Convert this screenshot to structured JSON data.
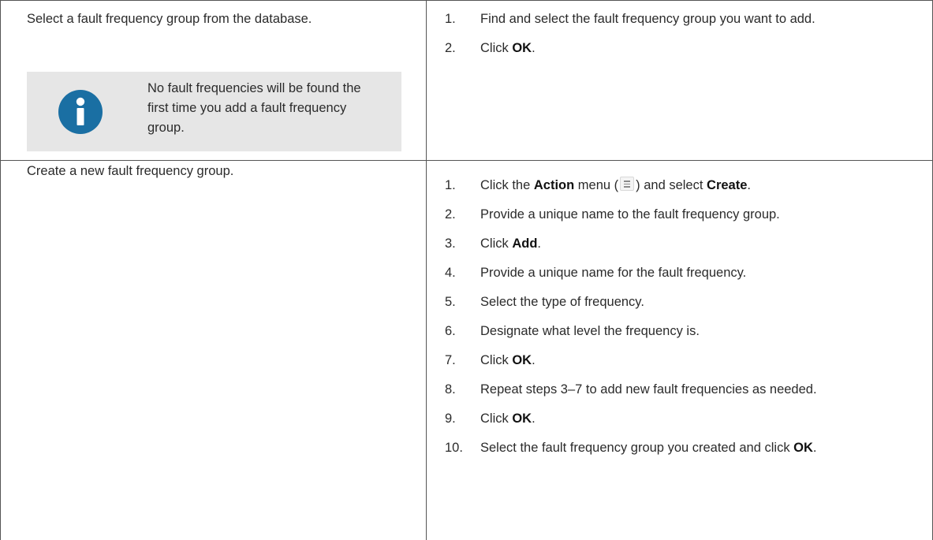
{
  "rows": [
    {
      "task": "Select a fault frequency group from the database.",
      "note": "No fault frequencies will be found the first time you add a fault frequency group.",
      "steps": [
        {
          "num": "1.",
          "text": "Find and select the fault frequency group you want to add."
        },
        {
          "num": "2.",
          "pre": "Click ",
          "bold": "OK",
          "post": "."
        }
      ]
    },
    {
      "task": "Create a new fault frequency group.",
      "steps": [
        {
          "num": "1.",
          "pre": "Click the ",
          "bold": "Action",
          "mid": " menu (",
          "mid2": ") and select ",
          "bold2": "Create",
          "post": "."
        },
        {
          "num": "2.",
          "text": "Provide a unique name to the fault frequency group."
        },
        {
          "num": "3.",
          "pre": "Click ",
          "bold": "Add",
          "post": "."
        },
        {
          "num": "4.",
          "text": "Provide a unique name for the fault frequency."
        },
        {
          "num": "5.",
          "text": "Select the type of frequency."
        },
        {
          "num": "6.",
          "text": "Designate what level the frequency is."
        },
        {
          "num": "7.",
          "pre": "Click ",
          "bold": "OK",
          "post": "."
        },
        {
          "num": "8.",
          "text": "Repeat steps 3–7 to add new fault frequencies as needed."
        },
        {
          "num": "9.",
          "pre": "Click ",
          "bold": "OK",
          "post": "."
        },
        {
          "num": "10.",
          "pre": "Select the fault frequency group you created and click ",
          "bold": "OK",
          "post": "."
        }
      ]
    }
  ],
  "icons": {
    "note": "info-icon",
    "menu": "action-menu-icon"
  },
  "colors": {
    "info_blue": "#1a6fa3",
    "note_bg": "#e6e6e6",
    "border": "#555555"
  }
}
